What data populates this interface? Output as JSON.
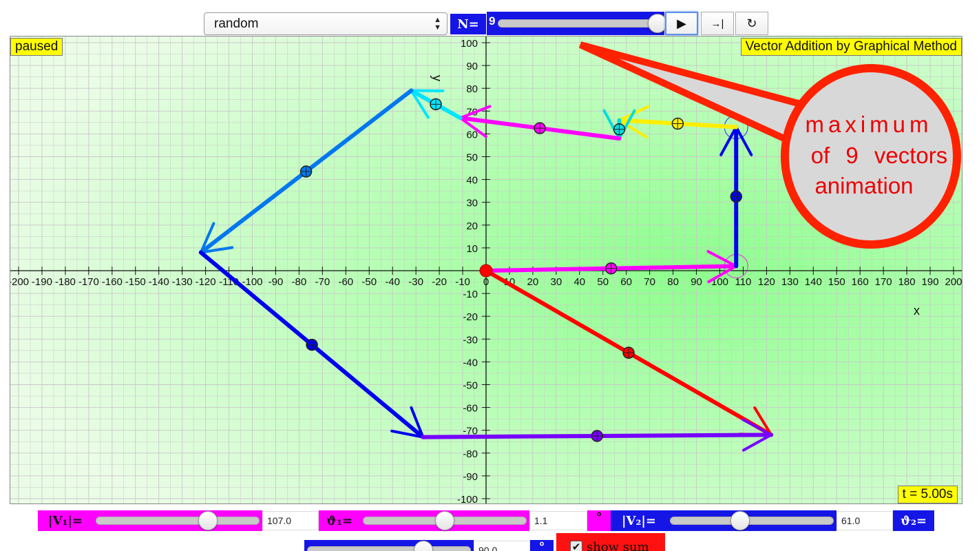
{
  "toolbar": {
    "preset_value": "random",
    "n_label": "N=",
    "n_value": "9",
    "play_icon": "play-icon",
    "step_icon": "step-icon",
    "reset_icon": "reset-icon",
    "n_fraction": 1.0
  },
  "plot": {
    "status": "paused",
    "title": "Vector Addition by Graphical Method",
    "time": "t = 5.00s",
    "axis": {
      "x_label": "x",
      "y_label": "y",
      "xlim": [
        -200,
        200
      ],
      "ylim": [
        -100,
        100
      ],
      "x_ticks": [
        -200,
        -190,
        -180,
        -170,
        -160,
        -150,
        -140,
        -130,
        -120,
        -110,
        -100,
        -90,
        -80,
        -70,
        -60,
        -50,
        -40,
        -30,
        -20,
        -10,
        0,
        10,
        20,
        30,
        40,
        50,
        60,
        70,
        80,
        90,
        100,
        110,
        120,
        130,
        140,
        150,
        160,
        170,
        180,
        190,
        200
      ],
      "y_ticks": [
        -100,
        -90,
        -80,
        -70,
        -60,
        -50,
        -40,
        -30,
        -20,
        -10,
        0,
        10,
        20,
        30,
        40,
        50,
        60,
        70,
        80,
        90,
        100
      ]
    },
    "callout_lines": [
      "maximum",
      "of 9 vectors",
      "animation"
    ],
    "colors": {
      "background": "#eafce6",
      "glow": "#8cff8c",
      "grid": "#c8c8c8",
      "callout_fill": "#d8d8d8",
      "callout_border": "#ff2200",
      "callout_text": "#ee0000"
    },
    "vectors": [
      {
        "from": [
          0,
          0
        ],
        "to": [
          107,
          2
        ],
        "color": "#ff00ff",
        "ghost": true
      },
      {
        "from": [
          107,
          2
        ],
        "to": [
          107,
          63
        ],
        "color": "#0000ee",
        "ghost": true
      },
      {
        "from": [
          107,
          63
        ],
        "to": [
          57,
          66
        ],
        "color": "#ffee00",
        "ghost": false
      },
      {
        "from": [
          57,
          66
        ],
        "to": [
          57,
          58
        ],
        "color": "#00dddd",
        "ghost": false
      },
      {
        "from": [
          57,
          58
        ],
        "to": [
          -11,
          67
        ],
        "color": "#ff00ff",
        "ghost": false
      },
      {
        "from": [
          -11,
          67
        ],
        "to": [
          -32,
          79
        ],
        "color": "#00e5ff",
        "ghost": false
      },
      {
        "from": [
          -32,
          79
        ],
        "to": [
          -122,
          8
        ],
        "color": "#0077ee",
        "ghost": false
      },
      {
        "from": [
          -122,
          8
        ],
        "to": [
          -27,
          -73
        ],
        "color": "#0000ee",
        "ghost": false
      },
      {
        "from": [
          -27,
          -73
        ],
        "to": [
          122,
          -72
        ],
        "color": "#7700ff",
        "ghost": false
      }
    ],
    "sum_vector": {
      "from": [
        0,
        0
      ],
      "to": [
        122,
        -72
      ],
      "color": "#ff0000"
    },
    "origin_color": "#ff0000"
  },
  "controls": {
    "v1_label": "|V₁|=",
    "v1_value": "107.0",
    "v1_fraction": 0.71,
    "theta1_label": "ϑ₁=",
    "theta1_value": "1.1",
    "theta1_fraction": 0.5,
    "degree_symbol": "°",
    "v2_label": "|V₂|=",
    "v2_value": "61.0",
    "v2_fraction": 0.42,
    "theta2_label": "ϑ₂=",
    "theta2_value": "90.0",
    "theta2_fraction": 0.74,
    "degree_symbol_2": "°",
    "show_sum_label": "show sum",
    "show_sum_checked": "✔",
    "colors": {
      "magenta": "#ff00ff",
      "blue": "#1515e6",
      "red": "#ff1111"
    }
  }
}
